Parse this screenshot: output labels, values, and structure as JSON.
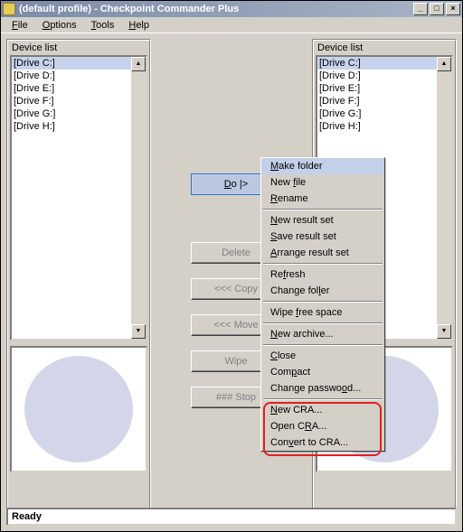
{
  "titlebar": {
    "title": "(default profile) - Checkpoint Commander Plus",
    "minimize": "_",
    "maximize": "□",
    "close": "×"
  },
  "menubar": {
    "file": "File",
    "options": "Options",
    "tools": "Tools",
    "help": "Help"
  },
  "panel": {
    "label": "Device list",
    "drives": [
      "[Drive C:]",
      "[Drive D:]",
      "[Drive E:]",
      "[Drive F:]",
      "[Drive G:]",
      "[Drive H:]"
    ]
  },
  "buttons": {
    "do": "Do |>",
    "delete": "Delete",
    "copy": "<<< Copy",
    "move": "<<< Move",
    "wipe": "Wipe",
    "stop": "### Stop"
  },
  "context": {
    "make_folder": "Make folder",
    "new_file": "New file",
    "rename": "Rename",
    "new_result_set": "New result set",
    "save_result_set": "Save result set",
    "arrange_result_set": "Arrange result set",
    "refresh": "Refresh",
    "change_folder": "Change folder",
    "wipe_free_space": "Wipe free space",
    "new_archive": "New archive...",
    "close": "Close",
    "compact": "Compact",
    "change_password": "Change password...",
    "new_cra": "New CRA...",
    "open_cra": "Open CRA...",
    "convert_cra": "Convert to CRA..."
  },
  "status": {
    "text": "Ready"
  }
}
